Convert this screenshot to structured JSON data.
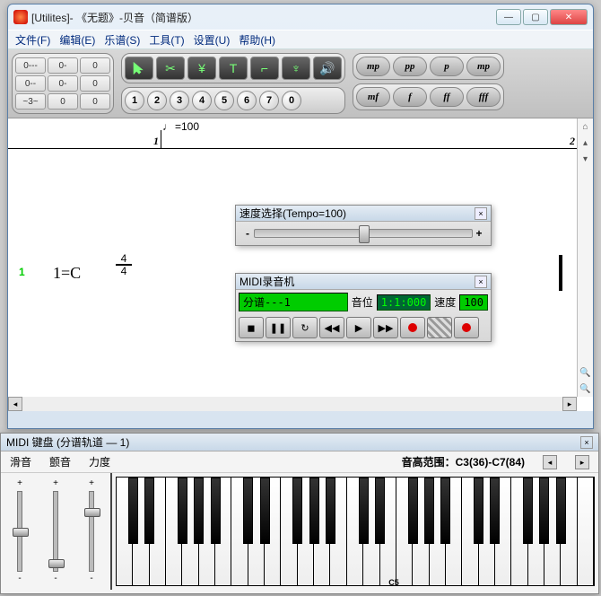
{
  "window": {
    "title": "[Utilites]- 《无题》-贝音（简谱版）"
  },
  "menu": {
    "file": "文件(F)",
    "edit": "编辑(E)",
    "score": "乐谱(S)",
    "tools": "工具(T)",
    "settings": "设置(U)",
    "help": "帮助(H)"
  },
  "toolbar": {
    "grid": [
      "0---",
      "0-",
      "0",
      "0--",
      "0-",
      "0",
      "~3~",
      "0",
      "0"
    ],
    "numbers": [
      "1",
      "2",
      "3",
      "4",
      "5",
      "6",
      "7",
      "0"
    ],
    "dynamics_row1": [
      "mp",
      "pp",
      "p",
      "mp"
    ],
    "dynamics_row2": [
      "mf",
      "f",
      "ff",
      "fff"
    ]
  },
  "score": {
    "tempo_label": "=100",
    "measure1": "1",
    "measure2": "2",
    "track_num": "1",
    "key": "1=C",
    "time_top": "4",
    "time_bot": "4"
  },
  "tempo_panel": {
    "title": "速度选择(Tempo=100)",
    "minus": "-",
    "plus": "+"
  },
  "recorder": {
    "title": "MIDI录音机",
    "part_label": "分谱---1",
    "pos_label": "音位",
    "pos_value": "1:1:000",
    "speed_label": "速度",
    "speed_value": "100"
  },
  "keyboard": {
    "title": "MIDI 键盘 (分谱轨道 — 1)",
    "slide": "滑音",
    "vibrato": "颤音",
    "velocity": "力度",
    "range_label": "音高范围：C3(36)-C7(84)",
    "c5": "C5"
  }
}
